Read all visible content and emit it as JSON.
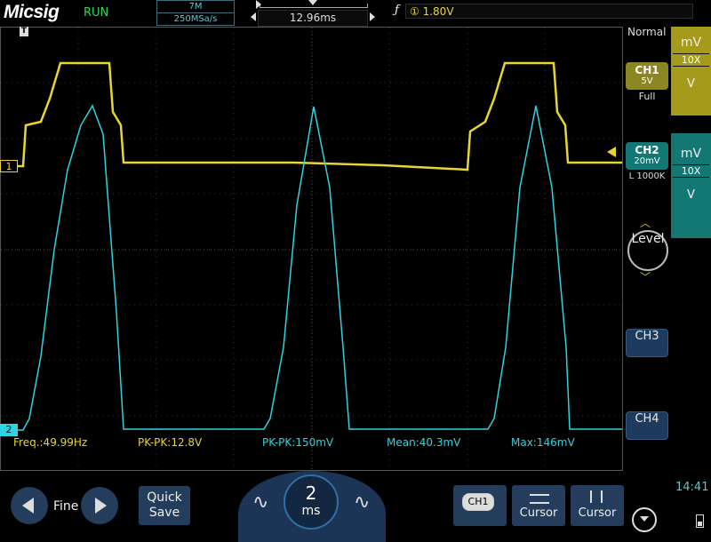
{
  "header": {
    "brand": "Micsig",
    "run_state": "RUN",
    "memory_depth": "7M",
    "sample_rate": "250MSa/s",
    "trigger_position": "12.96ms",
    "trigger_level": "1.80V",
    "trigger_source_marker": "①"
  },
  "channels": {
    "ch1": {
      "name": "CH1",
      "scale": "5V",
      "mode": "Full",
      "unit": "mV",
      "probe": "10X",
      "unit_button": "V",
      "color": "#e8d52e",
      "marker": "1"
    },
    "ch2": {
      "name": "CH2",
      "scale": "20mV",
      "coupling": "L 1000K",
      "unit": "mV",
      "probe": "10X",
      "unit_button": "V",
      "color": "#2ed4df",
      "marker": "2"
    },
    "ch3": {
      "name": "CH3"
    },
    "ch4": {
      "name": "CH4"
    }
  },
  "acquisition_mode": "Normal",
  "level_button": "Level",
  "measurements": [
    {
      "label": "Freq.:49.99Hz",
      "color": "#e8d52e"
    },
    {
      "label": "PK-PK:12.8V",
      "color": "#e8d52e"
    },
    {
      "label": "PK-PK:150mV",
      "color": "#2ed4df"
    },
    {
      "label": "Mean:40.3mV",
      "color": "#2ed4df"
    },
    {
      "label": "Max:146mV",
      "color": "#2ed4df"
    }
  ],
  "bottom": {
    "fine_label": "Fine",
    "quick_save_line1": "Quick",
    "quick_save_line2": "Save",
    "timebase_value": "2",
    "timebase_unit": "ms",
    "ch1_tab": "CH1",
    "cursor1": "Cursor",
    "cursor2": "Cursor",
    "clock": "14:41"
  },
  "icons": [
    "left-arrow-icon",
    "right-arrow-icon",
    "sine-wave-icon",
    "horizontal-cursor-icon",
    "vertical-cursor-icon",
    "power-icon",
    "battery-icon",
    "trigger-rising-edge-icon",
    "trigger-time-marker-icon"
  ]
}
